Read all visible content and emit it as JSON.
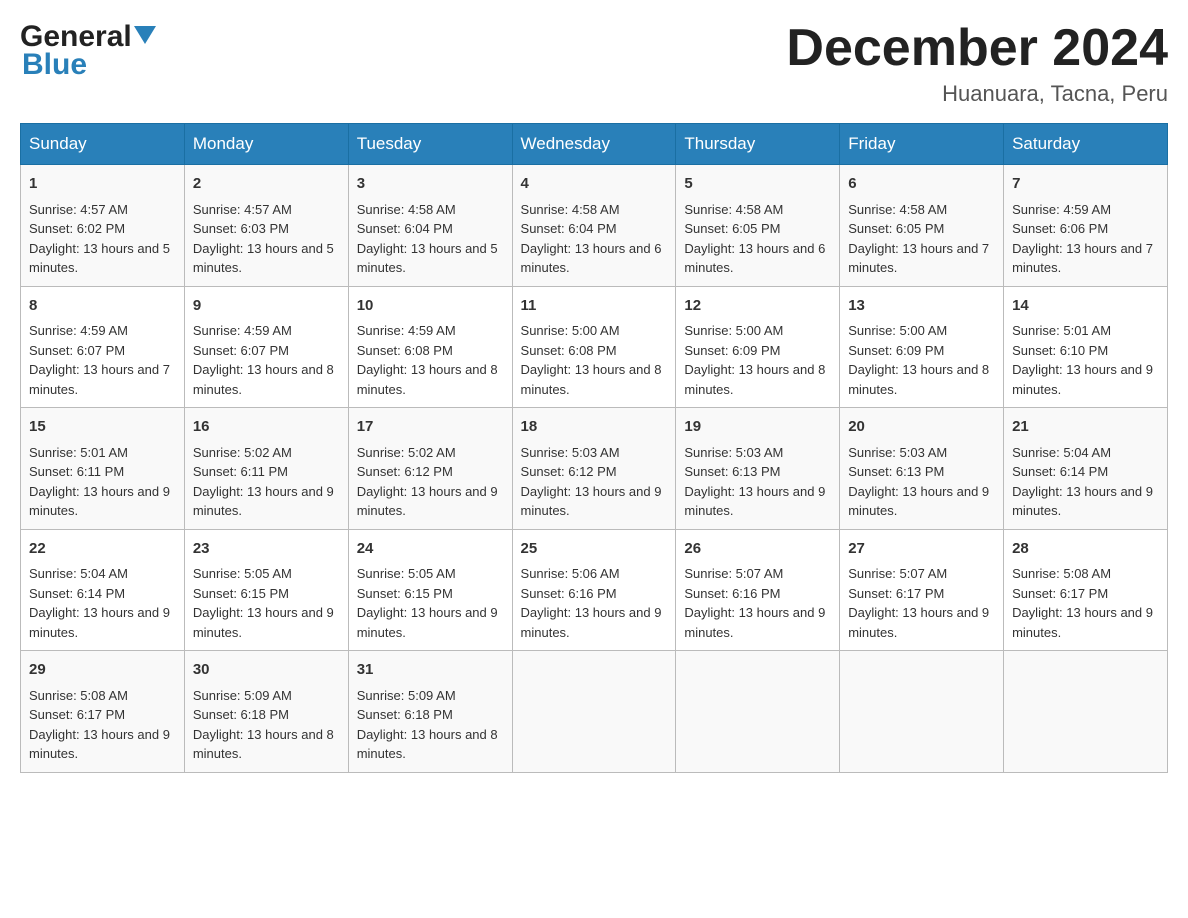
{
  "header": {
    "logo_line1": "General",
    "logo_line2": "Blue",
    "title": "December 2024",
    "subtitle": "Huanuara, Tacna, Peru"
  },
  "days_of_week": [
    "Sunday",
    "Monday",
    "Tuesday",
    "Wednesday",
    "Thursday",
    "Friday",
    "Saturday"
  ],
  "weeks": [
    [
      {
        "day": "1",
        "sunrise": "Sunrise: 4:57 AM",
        "sunset": "Sunset: 6:02 PM",
        "daylight": "Daylight: 13 hours and 5 minutes."
      },
      {
        "day": "2",
        "sunrise": "Sunrise: 4:57 AM",
        "sunset": "Sunset: 6:03 PM",
        "daylight": "Daylight: 13 hours and 5 minutes."
      },
      {
        "day": "3",
        "sunrise": "Sunrise: 4:58 AM",
        "sunset": "Sunset: 6:04 PM",
        "daylight": "Daylight: 13 hours and 5 minutes."
      },
      {
        "day": "4",
        "sunrise": "Sunrise: 4:58 AM",
        "sunset": "Sunset: 6:04 PM",
        "daylight": "Daylight: 13 hours and 6 minutes."
      },
      {
        "day": "5",
        "sunrise": "Sunrise: 4:58 AM",
        "sunset": "Sunset: 6:05 PM",
        "daylight": "Daylight: 13 hours and 6 minutes."
      },
      {
        "day": "6",
        "sunrise": "Sunrise: 4:58 AM",
        "sunset": "Sunset: 6:05 PM",
        "daylight": "Daylight: 13 hours and 7 minutes."
      },
      {
        "day": "7",
        "sunrise": "Sunrise: 4:59 AM",
        "sunset": "Sunset: 6:06 PM",
        "daylight": "Daylight: 13 hours and 7 minutes."
      }
    ],
    [
      {
        "day": "8",
        "sunrise": "Sunrise: 4:59 AM",
        "sunset": "Sunset: 6:07 PM",
        "daylight": "Daylight: 13 hours and 7 minutes."
      },
      {
        "day": "9",
        "sunrise": "Sunrise: 4:59 AM",
        "sunset": "Sunset: 6:07 PM",
        "daylight": "Daylight: 13 hours and 8 minutes."
      },
      {
        "day": "10",
        "sunrise": "Sunrise: 4:59 AM",
        "sunset": "Sunset: 6:08 PM",
        "daylight": "Daylight: 13 hours and 8 minutes."
      },
      {
        "day": "11",
        "sunrise": "Sunrise: 5:00 AM",
        "sunset": "Sunset: 6:08 PM",
        "daylight": "Daylight: 13 hours and 8 minutes."
      },
      {
        "day": "12",
        "sunrise": "Sunrise: 5:00 AM",
        "sunset": "Sunset: 6:09 PM",
        "daylight": "Daylight: 13 hours and 8 minutes."
      },
      {
        "day": "13",
        "sunrise": "Sunrise: 5:00 AM",
        "sunset": "Sunset: 6:09 PM",
        "daylight": "Daylight: 13 hours and 8 minutes."
      },
      {
        "day": "14",
        "sunrise": "Sunrise: 5:01 AM",
        "sunset": "Sunset: 6:10 PM",
        "daylight": "Daylight: 13 hours and 9 minutes."
      }
    ],
    [
      {
        "day": "15",
        "sunrise": "Sunrise: 5:01 AM",
        "sunset": "Sunset: 6:11 PM",
        "daylight": "Daylight: 13 hours and 9 minutes."
      },
      {
        "day": "16",
        "sunrise": "Sunrise: 5:02 AM",
        "sunset": "Sunset: 6:11 PM",
        "daylight": "Daylight: 13 hours and 9 minutes."
      },
      {
        "day": "17",
        "sunrise": "Sunrise: 5:02 AM",
        "sunset": "Sunset: 6:12 PM",
        "daylight": "Daylight: 13 hours and 9 minutes."
      },
      {
        "day": "18",
        "sunrise": "Sunrise: 5:03 AM",
        "sunset": "Sunset: 6:12 PM",
        "daylight": "Daylight: 13 hours and 9 minutes."
      },
      {
        "day": "19",
        "sunrise": "Sunrise: 5:03 AM",
        "sunset": "Sunset: 6:13 PM",
        "daylight": "Daylight: 13 hours and 9 minutes."
      },
      {
        "day": "20",
        "sunrise": "Sunrise: 5:03 AM",
        "sunset": "Sunset: 6:13 PM",
        "daylight": "Daylight: 13 hours and 9 minutes."
      },
      {
        "day": "21",
        "sunrise": "Sunrise: 5:04 AM",
        "sunset": "Sunset: 6:14 PM",
        "daylight": "Daylight: 13 hours and 9 minutes."
      }
    ],
    [
      {
        "day": "22",
        "sunrise": "Sunrise: 5:04 AM",
        "sunset": "Sunset: 6:14 PM",
        "daylight": "Daylight: 13 hours and 9 minutes."
      },
      {
        "day": "23",
        "sunrise": "Sunrise: 5:05 AM",
        "sunset": "Sunset: 6:15 PM",
        "daylight": "Daylight: 13 hours and 9 minutes."
      },
      {
        "day": "24",
        "sunrise": "Sunrise: 5:05 AM",
        "sunset": "Sunset: 6:15 PM",
        "daylight": "Daylight: 13 hours and 9 minutes."
      },
      {
        "day": "25",
        "sunrise": "Sunrise: 5:06 AM",
        "sunset": "Sunset: 6:16 PM",
        "daylight": "Daylight: 13 hours and 9 minutes."
      },
      {
        "day": "26",
        "sunrise": "Sunrise: 5:07 AM",
        "sunset": "Sunset: 6:16 PM",
        "daylight": "Daylight: 13 hours and 9 minutes."
      },
      {
        "day": "27",
        "sunrise": "Sunrise: 5:07 AM",
        "sunset": "Sunset: 6:17 PM",
        "daylight": "Daylight: 13 hours and 9 minutes."
      },
      {
        "day": "28",
        "sunrise": "Sunrise: 5:08 AM",
        "sunset": "Sunset: 6:17 PM",
        "daylight": "Daylight: 13 hours and 9 minutes."
      }
    ],
    [
      {
        "day": "29",
        "sunrise": "Sunrise: 5:08 AM",
        "sunset": "Sunset: 6:17 PM",
        "daylight": "Daylight: 13 hours and 9 minutes."
      },
      {
        "day": "30",
        "sunrise": "Sunrise: 5:09 AM",
        "sunset": "Sunset: 6:18 PM",
        "daylight": "Daylight: 13 hours and 8 minutes."
      },
      {
        "day": "31",
        "sunrise": "Sunrise: 5:09 AM",
        "sunset": "Sunset: 6:18 PM",
        "daylight": "Daylight: 13 hours and 8 minutes."
      },
      null,
      null,
      null,
      null
    ]
  ]
}
